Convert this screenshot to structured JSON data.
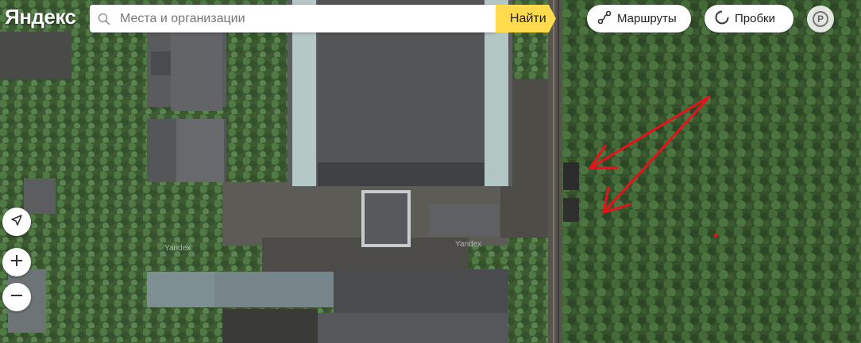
{
  "brand": {
    "logo_text": "Яндекс"
  },
  "search": {
    "placeholder": "Места и организации",
    "value": "",
    "button_label": "Найти"
  },
  "controls": {
    "routes_label": "Маршруты",
    "traffic_label": "Пробки",
    "parking_label": "P"
  },
  "watermarks": [
    "Yandex",
    "Yandex"
  ],
  "map_layer": "satellite",
  "annotations": {
    "arrow_color": "#e8121a",
    "arrow_count": 2,
    "dot_color": "#e8121a"
  },
  "colors": {
    "find_button": "#ffdb4d",
    "panel": "#ffffff"
  }
}
